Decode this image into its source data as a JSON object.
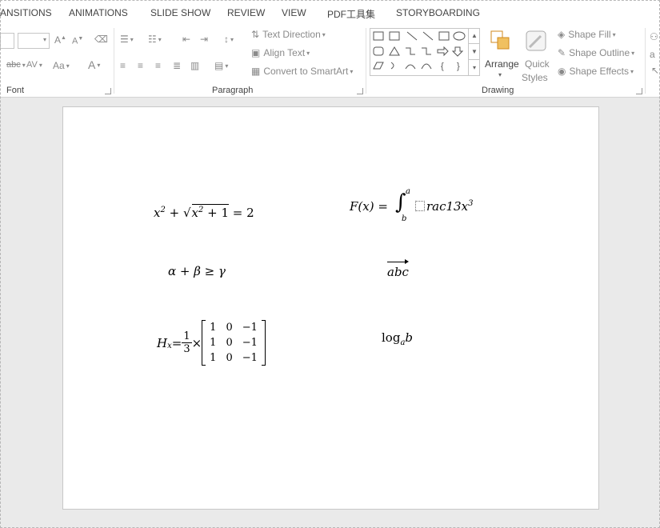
{
  "tabs": [
    "ANSITIONS",
    "ANIMATIONS",
    "SLIDE SHOW",
    "REVIEW",
    "VIEW",
    "PDF工具集",
    "STORYBOARDING"
  ],
  "ribbon": {
    "font_group": "Font",
    "paragraph_group": "Paragraph",
    "drawing_group": "Drawing",
    "text_direction": "Text Direction",
    "align_text": "Align Text",
    "convert_smartart": "Convert to SmartArt",
    "arrange": "Arrange",
    "quick_styles_1": "Quick",
    "quick_styles_2": "Styles",
    "shape_fill": "Shape Fill",
    "shape_outline": "Shape Outline",
    "shape_effects": "Shape Effects",
    "font_abc": "abc",
    "font_av": "AV",
    "font_aa": "Aa",
    "font_a": "A"
  },
  "equations": {
    "eq1_a": "x",
    "eq1_exp": "2",
    "eq1_plus": " + ",
    "eq1_root": "√",
    "eq1_inner": "x",
    "eq1_inner_exp": "2",
    "eq1_inner_rest": " + 1",
    "eq1_rhs": " = 2",
    "eq2_lhs": "F(x) = ",
    "eq2_int": "∫",
    "eq2_upper": "a",
    "eq2_lower": "b",
    "eq2_body": "rac13x",
    "eq2_exp": "3",
    "eq3": "α + β ≥ γ",
    "eq4": "abc",
    "eq5_lhs": "H",
    "eq5_sub": "x",
    "eq5_eq": " = ",
    "eq5_num": "1",
    "eq5_den": "3",
    "eq5_times": " × ",
    "matrix": [
      [
        "1",
        "0",
        "−1"
      ],
      [
        "1",
        "0",
        "−1"
      ],
      [
        "1",
        "0",
        "−1"
      ]
    ],
    "eq6_log": "log",
    "eq6_sub": "a",
    "eq6_b": "b"
  }
}
